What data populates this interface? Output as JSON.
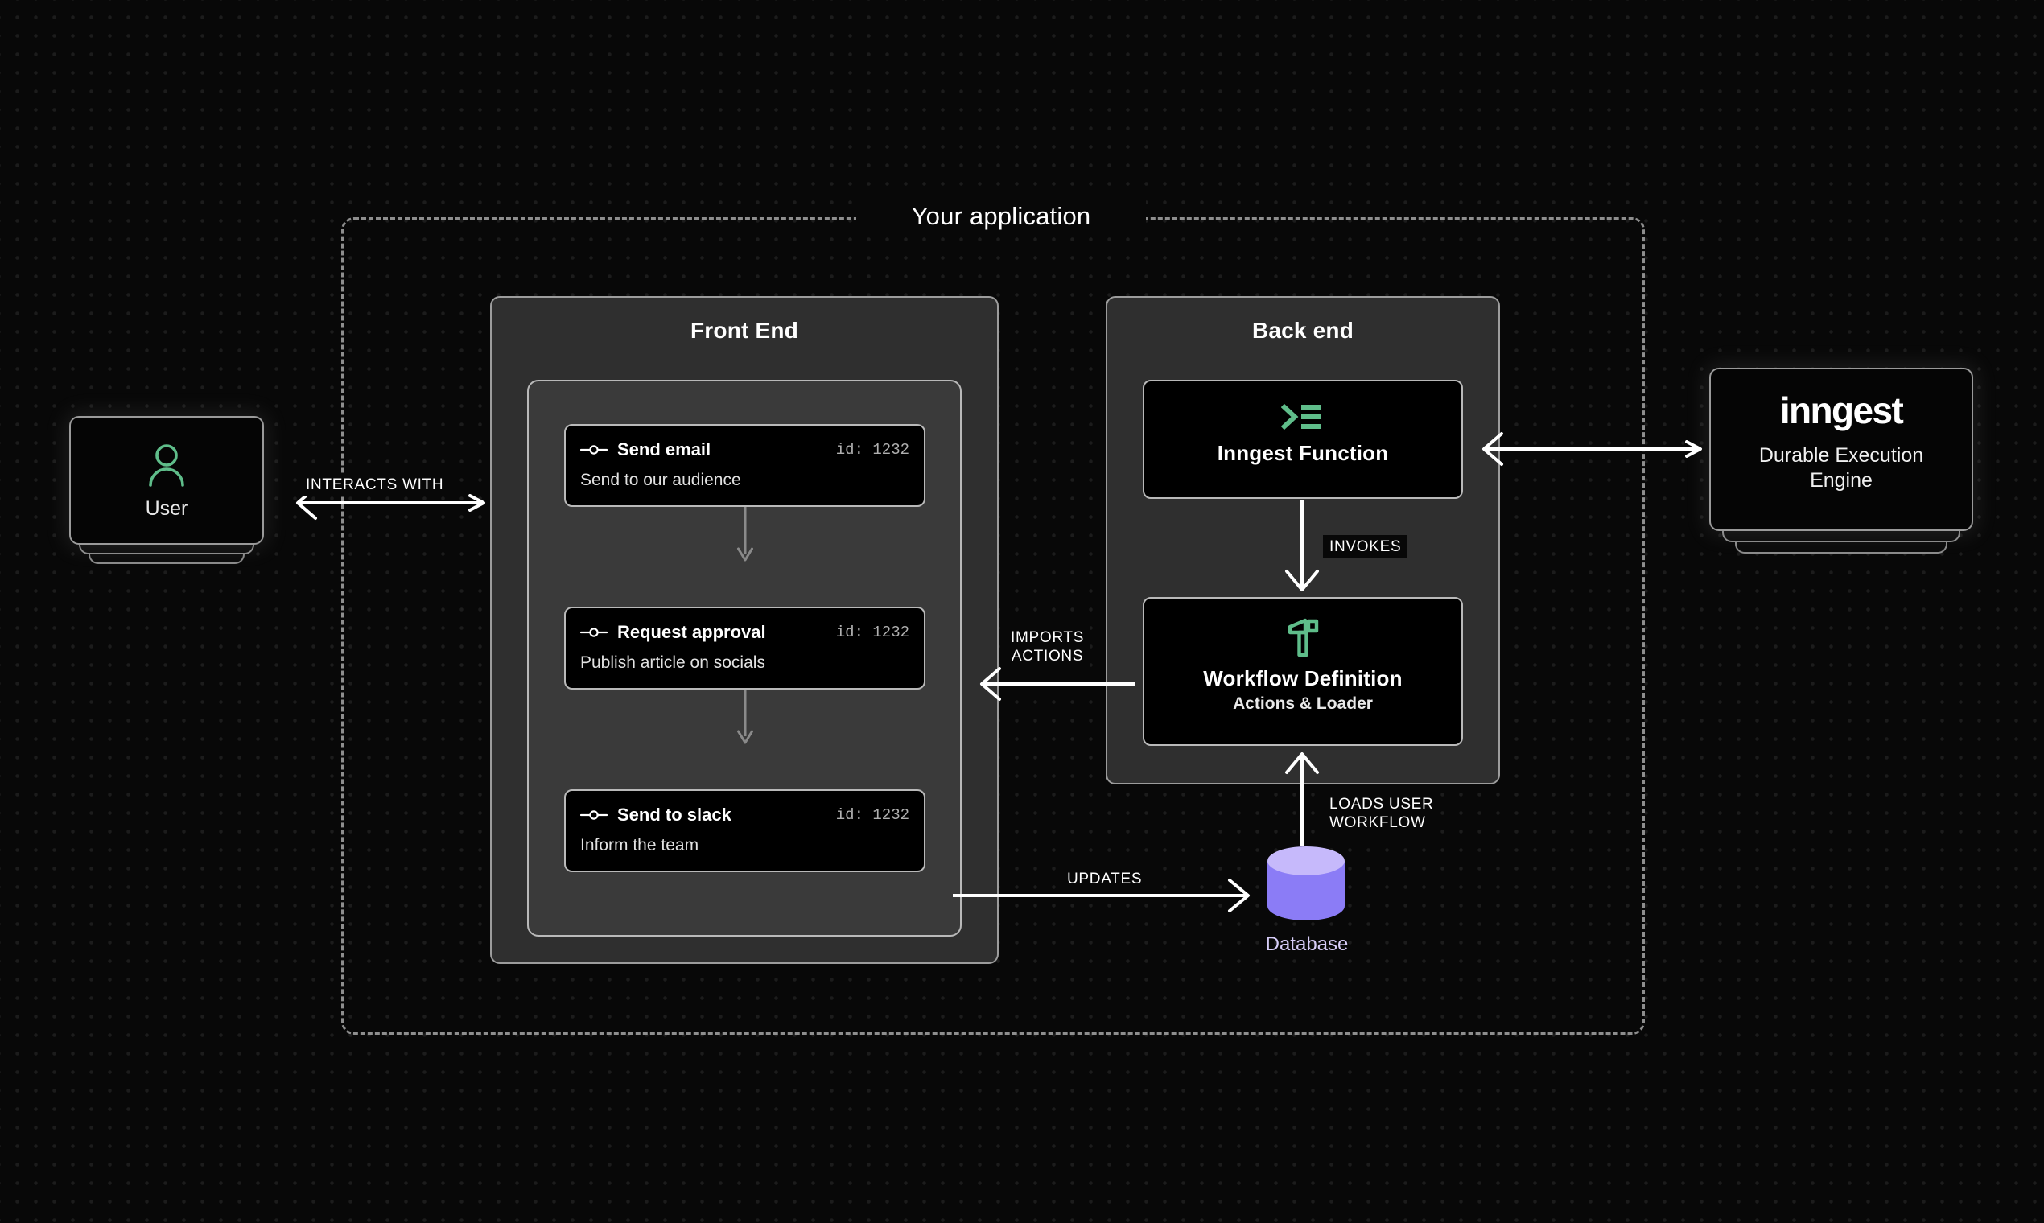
{
  "boundary": {
    "title": "Your application"
  },
  "groups": {
    "front_end": {
      "title": "Front End"
    },
    "back_end": {
      "title": "Back end"
    }
  },
  "workflow_steps": [
    {
      "name": "Send email",
      "id_label": "id: 1232",
      "description": "Send to our audience"
    },
    {
      "name": "Request approval",
      "id_label": "id: 1232",
      "description": "Publish article on socials"
    },
    {
      "name": "Send to slack",
      "id_label": "id: 1232",
      "description": "Inform the team"
    }
  ],
  "back_end_blocks": {
    "inngest_function": {
      "label": "Inngest Function",
      "icon": "terminal-icon"
    },
    "workflow_definition": {
      "label": "Workflow Definition",
      "sublabel": "Actions & Loader",
      "icon": "hammer-icon"
    }
  },
  "user_node": {
    "label": "User",
    "icon": "user-icon"
  },
  "inngest_node": {
    "wordmark": "inngest",
    "tagline": "Durable Execution\nEngine"
  },
  "database_node": {
    "label": "Database",
    "icon": "database-cylinder-icon"
  },
  "edges": {
    "interacts_with": "INTERACTS WITH",
    "imports_actions": "IMPORTS\nACTIONS",
    "invokes": "INVOKES",
    "loads_user_workflow": "LOADS USER\nWORKFLOW",
    "updates": "UPDATES"
  },
  "colors": {
    "background": "#080808",
    "accent_green": "#5fbd8a",
    "database_purple": "#8b7cf6",
    "database_top_purple": "#c6b9fb",
    "panel_gray": "#2f2f2f",
    "inner_gray": "#3a3a3a",
    "card_black": "#000000",
    "border_light": "#b9b9b9",
    "edge_white": "#ffffff",
    "connector_gray": "#8a8a8a"
  }
}
